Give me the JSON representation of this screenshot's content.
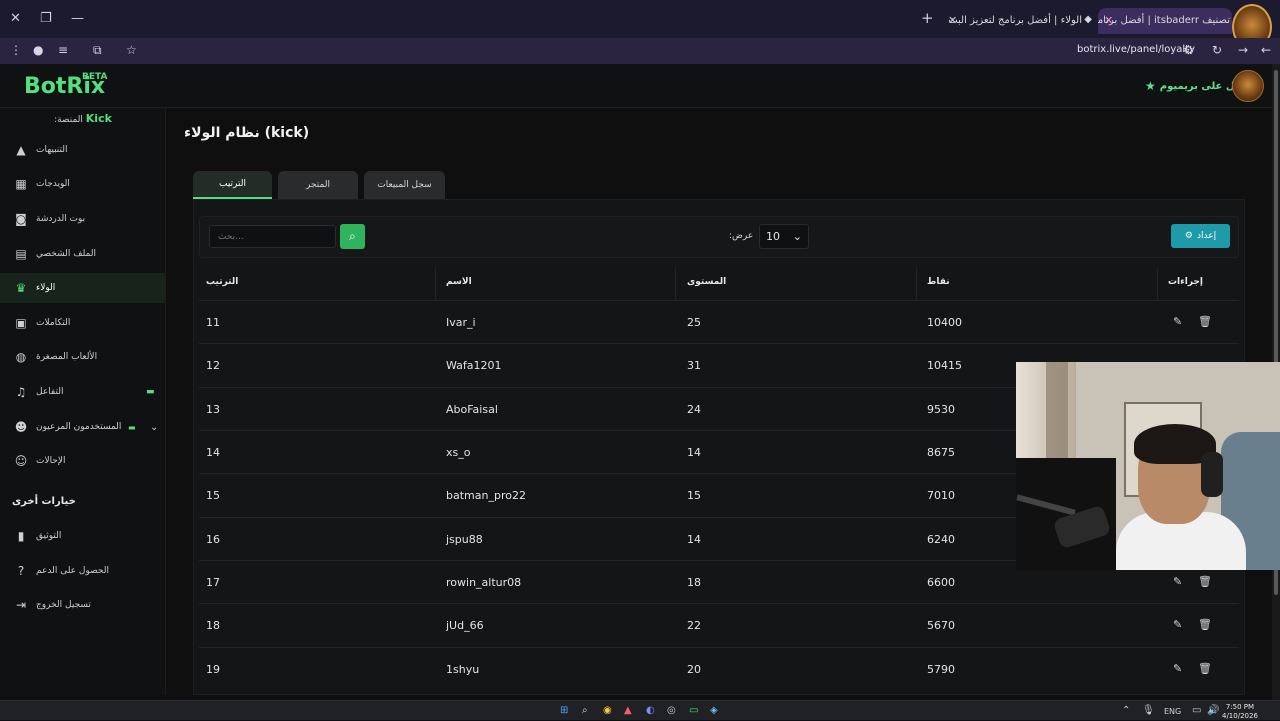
{
  "browser": {
    "tabs": [
      {
        "title": "تصنيف itsbaderr | أفضل برنامج",
        "active": true
      },
      {
        "title": "الولاء | أفضل برنامج لتعزيز البث",
        "active": false
      }
    ],
    "new_tab_label": "+",
    "url": "botrix.live/panel/loyalty"
  },
  "header": {
    "logo": "BotRix",
    "beta": "BETA",
    "premium_label": "احصل على بريميوم"
  },
  "sidebar": {
    "platform_label": ":المنصة",
    "platform_value": "Kick",
    "items": [
      {
        "label": "التنبيهات",
        "icon": "warning-icon"
      },
      {
        "label": "الويدجات",
        "icon": "widgets-icon"
      },
      {
        "label": "بوت الدردشة",
        "icon": "robot-icon"
      },
      {
        "label": "الملف الشخصي",
        "icon": "id-card-icon"
      },
      {
        "label": "الولاء",
        "icon": "trophy-icon",
        "active": true
      },
      {
        "label": "التكاملات",
        "icon": "puzzle-icon"
      },
      {
        "label": "الألعاب المصغرة",
        "icon": "gamepad-icon"
      },
      {
        "label": "التفاعل",
        "icon": "music-icon"
      },
      {
        "label": "المستخدمون المرعيون",
        "icon": "users-icon"
      },
      {
        "label": "الإحالات",
        "icon": "user-group-icon"
      }
    ],
    "other_title": "خيارات أخرى",
    "other_items": [
      {
        "label": "التوثيق",
        "icon": "book-icon"
      },
      {
        "label": "الحصول على الدعم",
        "icon": "help-icon"
      },
      {
        "label": "تسجيل الخروج",
        "icon": "logout-icon"
      }
    ]
  },
  "main": {
    "title": "نظام الولاء (kick)",
    "tabs": [
      "الترتيب",
      "المتجر",
      "سجل المبيعات"
    ],
    "search_placeholder": "بحث...",
    "show_label": ":عرض",
    "show_value": "10",
    "setup_label": "إعداد",
    "columns": [
      "الترتيب",
      "الاسم",
      "المستوى",
      "نقاط",
      "إجراءات"
    ],
    "rows": [
      {
        "rank": "11",
        "name": "Ivar_i",
        "level": "25",
        "points": "10400"
      },
      {
        "rank": "12",
        "name": "Wafa1201",
        "level": "31",
        "points": "10415"
      },
      {
        "rank": "13",
        "name": "AboFaisal",
        "level": "24",
        "points": "9530"
      },
      {
        "rank": "14",
        "name": "xs_o",
        "level": "14",
        "points": "8675"
      },
      {
        "rank": "15",
        "name": "batman_pro22",
        "level": "15",
        "points": "7010"
      },
      {
        "rank": "16",
        "name": "jspu88",
        "level": "14",
        "points": "6240"
      },
      {
        "rank": "17",
        "name": "rowin_altur08",
        "level": "18",
        "points": "6600"
      },
      {
        "rank": "18",
        "name": "jUd_66",
        "level": "22",
        "points": "5670"
      },
      {
        "rank": "19",
        "name": "1shyu",
        "level": "20",
        "points": "5790"
      }
    ]
  },
  "taskbar": {
    "lang": "ENG",
    "time": "7:50 PM",
    "date": "4/10/2026"
  },
  "colors": {
    "accent": "#53e07d",
    "setup_button": "#1f9aa8",
    "search_button": "#2fb35d"
  }
}
